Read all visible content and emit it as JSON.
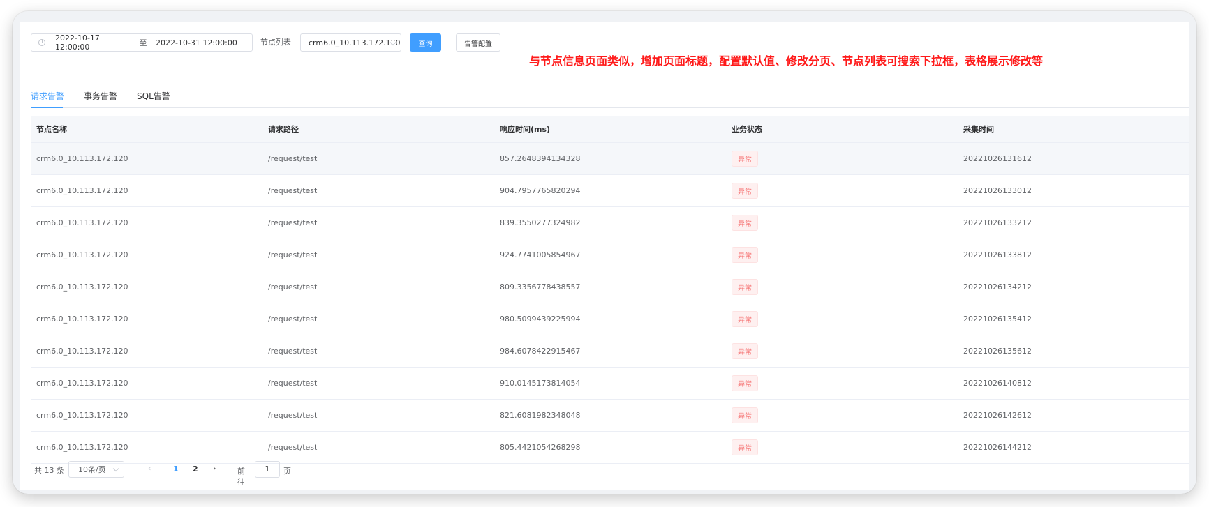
{
  "filters": {
    "date_start": "2022-10-17 12:00:00",
    "date_separator": "至",
    "date_end": "2022-10-31 12:00:00",
    "node_label": "节点列表",
    "node_value": "crm6.0_10.113.172.120",
    "query_button": "查询",
    "alarm_config_button": "告警配置"
  },
  "annotation": "与节点信息页面类似，增加页面标题，配置默认值、修改分页、节点列表可搜索下拉框，表格展示修改等",
  "tabs": [
    {
      "label": "请求告警",
      "active": true
    },
    {
      "label": "事务告警",
      "active": false
    },
    {
      "label": "SQL告警",
      "active": false
    }
  ],
  "table": {
    "headers": [
      "节点名称",
      "请求路径",
      "响应时间(ms)",
      "业务状态",
      "采集时间"
    ],
    "rows": [
      {
        "node": "crm6.0_10.113.172.120",
        "path": "/request/test",
        "response": "857.2648394134328",
        "status": "异常",
        "time": "20221026131612"
      },
      {
        "node": "crm6.0_10.113.172.120",
        "path": "/request/test",
        "response": "904.7957765820294",
        "status": "异常",
        "time": "20221026133012"
      },
      {
        "node": "crm6.0_10.113.172.120",
        "path": "/request/test",
        "response": "839.3550277324982",
        "status": "异常",
        "time": "20221026133212"
      },
      {
        "node": "crm6.0_10.113.172.120",
        "path": "/request/test",
        "response": "924.7741005854967",
        "status": "异常",
        "time": "20221026133812"
      },
      {
        "node": "crm6.0_10.113.172.120",
        "path": "/request/test",
        "response": "809.3356778438557",
        "status": "异常",
        "time": "20221026134212"
      },
      {
        "node": "crm6.0_10.113.172.120",
        "path": "/request/test",
        "response": "980.5099439225994",
        "status": "异常",
        "time": "20221026135412"
      },
      {
        "node": "crm6.0_10.113.172.120",
        "path": "/request/test",
        "response": "984.6078422915467",
        "status": "异常",
        "time": "20221026135612"
      },
      {
        "node": "crm6.0_10.113.172.120",
        "path": "/request/test",
        "response": "910.0145173814054",
        "status": "异常",
        "time": "20221026140812"
      },
      {
        "node": "crm6.0_10.113.172.120",
        "path": "/request/test",
        "response": "821.6081982348048",
        "status": "异常",
        "time": "20221026142612"
      },
      {
        "node": "crm6.0_10.113.172.120",
        "path": "/request/test",
        "response": "805.4421054268298",
        "status": "异常",
        "time": "20221026144212"
      }
    ]
  },
  "pagination": {
    "total": "共 13 条",
    "page_size": "10条/页",
    "pages": [
      "1",
      "2"
    ],
    "current_page": "1",
    "goto_label": "前往",
    "goto_value": "1",
    "page_unit": "页"
  },
  "colors": {
    "primary": "#409eff",
    "danger": "#f56c6c",
    "annotation": "#ff1a1a"
  },
  "icons": {
    "date_icon": "clock-icon",
    "prev": "chevron-left-icon",
    "next": "chevron-right-icon",
    "dropdown": "chevron-down-icon"
  }
}
